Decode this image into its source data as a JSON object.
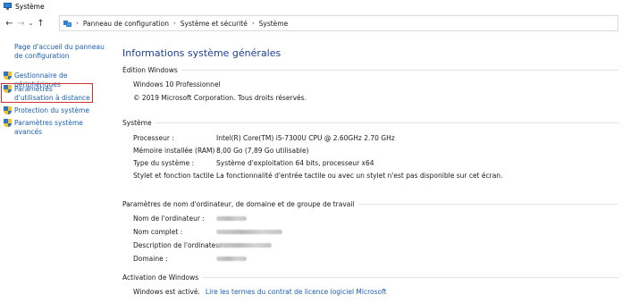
{
  "window": {
    "title": "Système"
  },
  "address": {
    "crumbs": [
      "Panneau de configuration",
      "Système et sécurité",
      "Système"
    ]
  },
  "sidebar": {
    "home_link": "Page d'accueil du panneau de configuration",
    "items": [
      {
        "label": "Gestionnaire de périphériques"
      },
      {
        "label": "Paramètres d'utilisation à distance"
      },
      {
        "label": "Protection du système"
      },
      {
        "label": "Paramètres système avancés"
      }
    ]
  },
  "main": {
    "heading": "Informations système générales",
    "edition": {
      "label": "Édition Windows",
      "name": "Windows 10 Professionnel",
      "copyright": "© 2019 Microsoft Corporation. Tous droits réservés."
    },
    "system": {
      "label": "Système",
      "rows": [
        {
          "key": "Processeur :",
          "value": "Intel(R) Core(TM) i5-7300U CPU @ 2.60GHz   2.70 GHz"
        },
        {
          "key": "Mémoire installée (RAM) :",
          "value": "8,00 Go (7,89 Go utilisable)"
        },
        {
          "key": "Type du système :",
          "value": "Système d'exploitation 64 bits, processeur x64"
        },
        {
          "key": "Stylet et fonction tactile :",
          "value": "La fonctionnalité d'entrée tactile ou avec un stylet n'est pas disponible sur cet écran."
        }
      ]
    },
    "computer": {
      "label": "Paramètres de nom d'ordinateur, de domaine et de groupe de travail",
      "rows": [
        {
          "key": "Nom de l'ordinateur :"
        },
        {
          "key": "Nom complet :"
        },
        {
          "key": "Description de l'ordinateur :"
        },
        {
          "key": "Domaine :"
        }
      ]
    },
    "activation": {
      "label": "Activation de Windows",
      "status": "Windows est activé.",
      "license_link": "Lire les termes du contrat de licence logiciel Microsoft"
    }
  },
  "colors": {
    "link": "#1a5fb4",
    "heading": "#1e3f91",
    "highlight": "#d0312d"
  },
  "icons": [
    "system-icon",
    "back-arrow-icon",
    "forward-arrow-icon",
    "recent-chevron-icon",
    "up-arrow-icon",
    "control-panel-icon",
    "uac-shield-icon"
  ]
}
